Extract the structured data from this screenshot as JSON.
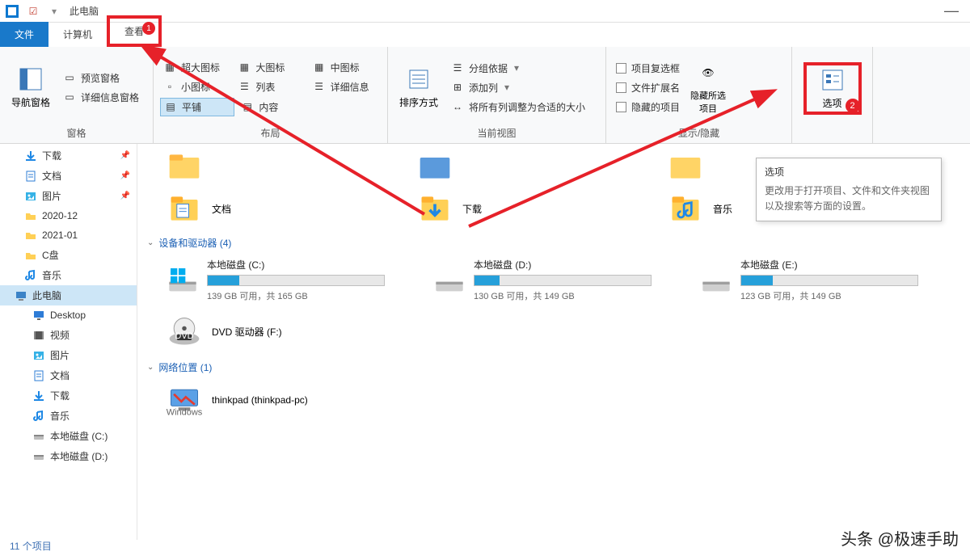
{
  "title": "此电脑",
  "tabs": {
    "file": "文件",
    "computer": "计算机",
    "view": "查看"
  },
  "ribbon": {
    "g1": {
      "nav": "导航窗格",
      "preview": "预览窗格",
      "details": "详细信息窗格",
      "caption": "窗格"
    },
    "g2": {
      "r1a": "超大图标",
      "r1b": "大图标",
      "r1c": "中图标",
      "r2a": "小图标",
      "r2b": "列表",
      "r2c": "详细信息",
      "r3a": "平铺",
      "r3b": "内容",
      "caption": "布局"
    },
    "g3": {
      "sort": "排序方式",
      "group": "分组依据",
      "addcol": "添加列",
      "fit": "将所有列调整为合适的大小",
      "caption": "当前视图"
    },
    "g4": {
      "chk1": "项目复选框",
      "chk2": "文件扩展名",
      "chk3": "隐藏的项目",
      "hide": "隐藏所选项目",
      "caption": "显示/隐藏"
    },
    "g5": {
      "options": "选项"
    }
  },
  "tooltip": {
    "title": "选项",
    "body": "更改用于打开项目、文件和文件夹视图以及搜索等方面的设置。"
  },
  "sidebar": [
    {
      "label": "下载",
      "icon": "download",
      "pin": true
    },
    {
      "label": "文档",
      "icon": "doc",
      "pin": true
    },
    {
      "label": "图片",
      "icon": "pic",
      "pin": true
    },
    {
      "label": "2020-12",
      "icon": "folder"
    },
    {
      "label": "2021-01",
      "icon": "folder"
    },
    {
      "label": "C盘",
      "icon": "folder"
    },
    {
      "label": "音乐",
      "icon": "music"
    },
    {
      "label": "此电脑",
      "icon": "pc",
      "sel": true,
      "indent": 1
    },
    {
      "label": "Desktop",
      "icon": "desktop",
      "indent": 2
    },
    {
      "label": "视频",
      "icon": "video",
      "indent": 2
    },
    {
      "label": "图片",
      "icon": "pic",
      "indent": 2
    },
    {
      "label": "文档",
      "icon": "doc",
      "indent": 2
    },
    {
      "label": "下载",
      "icon": "download",
      "indent": 2
    },
    {
      "label": "音乐",
      "icon": "music",
      "indent": 2
    },
    {
      "label": "本地磁盘 (C:)",
      "icon": "drive",
      "indent": 2
    },
    {
      "label": "本地磁盘 (D:)",
      "icon": "drive",
      "indent": 2
    }
  ],
  "folders": [
    {
      "label": "文档",
      "icon": "doc"
    },
    {
      "label": "下载",
      "icon": "download"
    },
    {
      "label": "音乐",
      "icon": "music"
    }
  ],
  "sections": {
    "devices": "设备和驱动器 (4)",
    "network": "网络位置 (1)"
  },
  "drives": [
    {
      "name": "本地磁盘 (C:)",
      "free": "139 GB 可用，共 165 GB",
      "fill": 18,
      "win": true
    },
    {
      "name": "本地磁盘 (D:)",
      "free": "130 GB 可用，共 149 GB",
      "fill": 14
    },
    {
      "name": "本地磁盘 (E:)",
      "free": "123 GB 可用，共 149 GB",
      "fill": 18
    }
  ],
  "dvd": "DVD 驱动器 (F:)",
  "network_item": "thinkpad (thinkpad-pc)",
  "status": "11 个项目",
  "credit": "头条 @极速手助"
}
